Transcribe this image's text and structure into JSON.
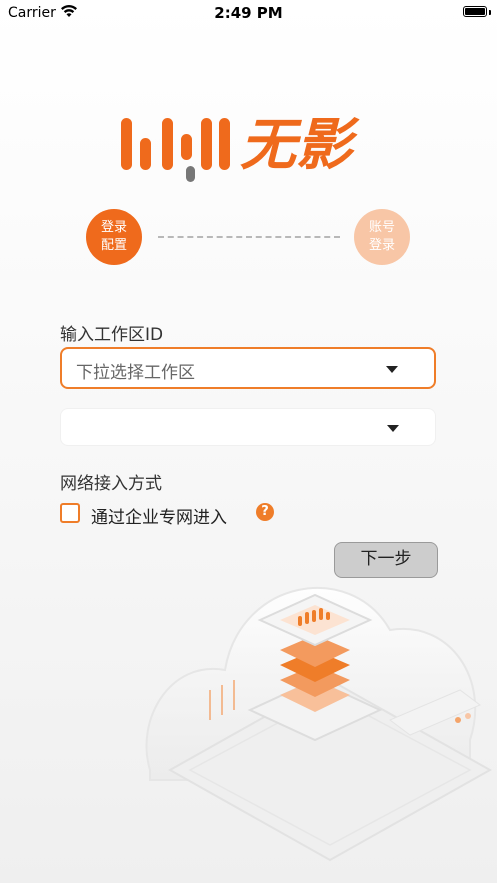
{
  "status_bar": {
    "carrier": "Carrier",
    "time": "2:49 PM"
  },
  "logo": {
    "text": "无影"
  },
  "steps": [
    {
      "line1": "登录",
      "line2": "配置",
      "active": true
    },
    {
      "line1": "账号",
      "line2": "登录",
      "active": false
    }
  ],
  "form": {
    "workspace_label": "输入工作区ID",
    "workspace_placeholder": "下拉选择工作区",
    "secondary_value": "",
    "network_label": "网络接入方式",
    "enterprise_network_option": "通过企业专网进入",
    "enterprise_network_checked": false,
    "help_icon_glyph": "?"
  },
  "actions": {
    "next_label": "下一步"
  },
  "colors": {
    "accent": "#ef6a1c",
    "accent_light": "#f8c6a6",
    "button_bg": "#cdcdcd"
  }
}
